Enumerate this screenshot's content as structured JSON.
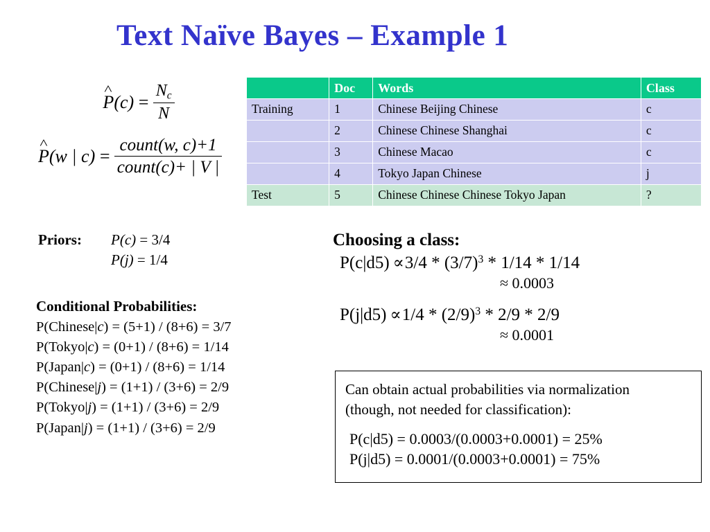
{
  "slide": {
    "title": "Text Naïve Bayes – Example 1",
    "title_color": "#3333cc"
  },
  "formulas": {
    "prior": {
      "lhs_hat": "P",
      "lhs_arg": "(c)",
      "equals": "=",
      "numerator": "N",
      "numerator_sub": "c",
      "denominator": "N"
    },
    "conditional": {
      "lhs_hat": "P",
      "lhs_arg": "(w | c)",
      "equals": "=",
      "numerator": "count(w, c)+1",
      "denominator": "count(c)+ | V |"
    }
  },
  "table": {
    "headers": {
      "label": "",
      "doc": "Doc",
      "words": "Words",
      "class": "Class"
    },
    "header_bg": "#0ac98a",
    "train_bg": "#ccccf0",
    "test_bg": "#c7e7d5",
    "rows": [
      {
        "label": "Training",
        "doc": "1",
        "words": "Chinese Beijing Chinese",
        "class": "c",
        "kind": "train"
      },
      {
        "label": "",
        "doc": "2",
        "words": "Chinese Chinese Shanghai",
        "class": "c",
        "kind": "train"
      },
      {
        "label": "",
        "doc": "3",
        "words": "Chinese Macao",
        "class": "c",
        "kind": "train"
      },
      {
        "label": "",
        "doc": "4",
        "words": "Tokyo Japan Chinese",
        "class": "j",
        "kind": "train"
      },
      {
        "label": "Test",
        "doc": "5",
        "words": "Chinese Chinese Chinese Tokyo Japan",
        "class": "?",
        "kind": "test"
      }
    ]
  },
  "priors": {
    "label": "Priors:",
    "line1_p": "P",
    "line1_arg": "(c)",
    "line1_val": " = 3/4",
    "line2_p": "P",
    "line2_arg": "(j)",
    "line2_val": " = 1/4"
  },
  "conditional_probabilities": {
    "heading": "Conditional Probabilities:",
    "lines": [
      {
        "head": "P(Chinese|",
        "cond": "c",
        "tail": ") = (5+1) / (8+6) = 3/7"
      },
      {
        "head": "P(Tokyo|",
        "cond": "c",
        "tail": ") = (0+1) / (8+6) = 1/14"
      },
      {
        "head": "P(Japan|",
        "cond": "c",
        "tail": ") = (0+1) / (8+6) = 1/14"
      },
      {
        "head": "P(Chinese|",
        "cond": "j",
        "tail": ") = (1+1) / (3+6) = 2/9"
      },
      {
        "head": "P(Tokyo|",
        "cond": "j",
        "tail": ") = (1+1) / (3+6) = 2/9"
      },
      {
        "head": "P(Japan|",
        "cond": "j",
        "tail": ") = (1+1) / (3+6) = 2/9"
      }
    ]
  },
  "choosing": {
    "heading": "Choosing a class:",
    "eq1": {
      "lhs": "P(c|d5)",
      "symbol": "∝",
      "part_a": "3/4 * (3/7)",
      "exponent": "3",
      "part_b": " * 1/14 * 1/14",
      "approx": "≈ 0.0003"
    },
    "eq2": {
      "lhs": "P(j|d5)",
      "symbol": "∝",
      "part_a": "1/4 * (2/9)",
      "exponent": "3",
      "part_b": " * 2/9 * 2/9",
      "approx": "≈ 0.0001"
    }
  },
  "normalization": {
    "line1": "Can obtain actual probabilities via normalization",
    "line2": "(though, not needed for classification):",
    "eq1": "P(c|d5) = 0.0003/(0.0003+0.0001) = 25%",
    "eq2": "P(j|d5)  = 0.0001/(0.0003+0.0001) = 75%"
  }
}
